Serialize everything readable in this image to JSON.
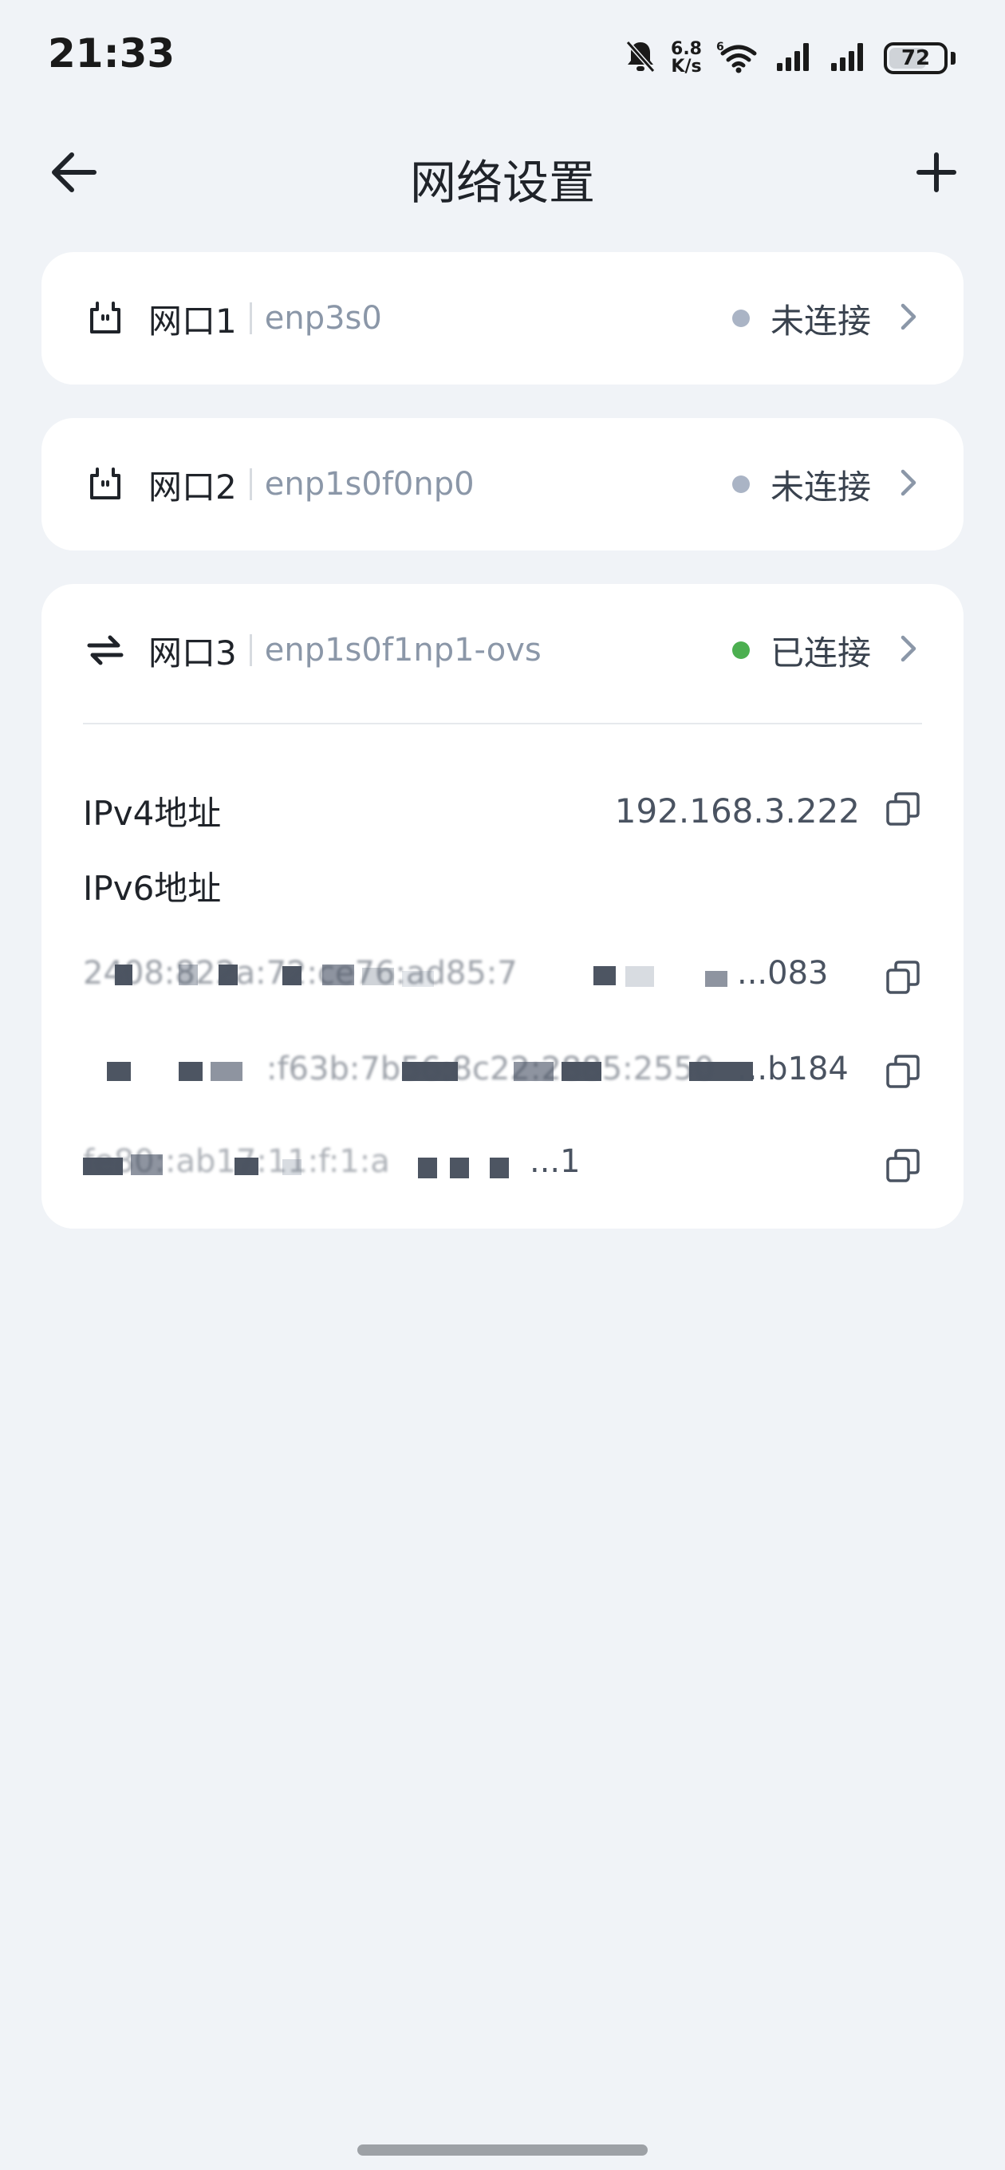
{
  "status_bar": {
    "time": "21:33",
    "net_speed_value": "6.8",
    "net_speed_unit": "K/s",
    "battery": "72",
    "battery_percent": 72,
    "icons": [
      "bell-off-icon",
      "wifi-icon",
      "signal-icon",
      "signal-icon",
      "battery-icon"
    ]
  },
  "header": {
    "title": "网络设置",
    "back_icon": "arrow-left-icon",
    "add_icon": "plus-icon"
  },
  "ports": [
    {
      "name": "网口1",
      "device": "enp3s0",
      "status": "未连接",
      "status_color": "#aab4c5",
      "icon": "ethernet-port-icon"
    },
    {
      "name": "网口2",
      "device": "enp1s0f0np0",
      "status": "未连接",
      "status_color": "#aab4c5",
      "icon": "ethernet-port-icon"
    },
    {
      "name": "网口3",
      "device": "enp1s0f1np1-ovs",
      "status": "已连接",
      "status_color": "#4caf50",
      "icon": "transfer-arrows-icon"
    }
  ],
  "details": {
    "ipv4_label": "IPv4地址",
    "ipv4_value": "192.168.3.222",
    "ipv6_label": "IPv6地址",
    "ipv6_values_visible_fragments": [
      "...083",
      "...b184",
      "...1"
    ]
  },
  "colors": {
    "background": "#f0f3f7",
    "card": "#ffffff",
    "connected": "#4caf50",
    "disconnected": "#aab4c5"
  }
}
